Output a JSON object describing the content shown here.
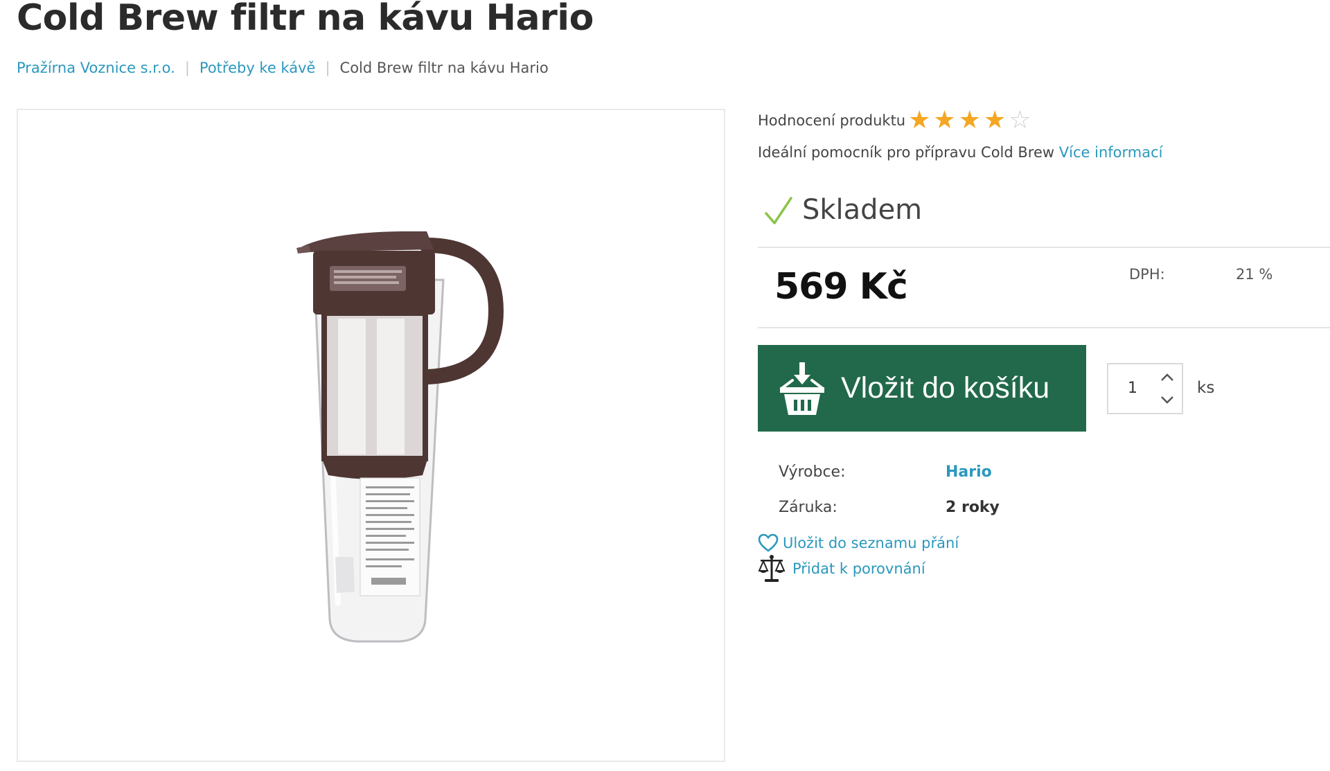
{
  "product": {
    "title": "Cold Brew filtr na kávu Hario"
  },
  "breadcrumb": {
    "items": [
      "Pražírna Voznice s.r.o.",
      "Potřeby ke kávě"
    ],
    "current": "Cold Brew filtr na kávu Hario",
    "separator": "|"
  },
  "image": {
    "alt_icon": "cold-brew-pitcher"
  },
  "rating": {
    "label": "Hodnocení produktu",
    "value": 4,
    "max": 5,
    "star_full": "★",
    "star_empty": "☆"
  },
  "short_description": {
    "text": "Ideální pomocník pro přípravu Cold Brew",
    "more_link": "Více informací"
  },
  "stock": {
    "label": "Skladem",
    "icon": "checkmark-icon"
  },
  "price": {
    "value": "569 Kč",
    "vat_label": "DPH:",
    "vat_value": "21 %"
  },
  "cart": {
    "button_label": "Vložit do košíku",
    "icon": "basket-icon",
    "quantity": "1",
    "unit": "ks"
  },
  "params": [
    {
      "label": "Výrobce:",
      "value": "Hario"
    },
    {
      "label": "Záruka:",
      "value": "2 roky"
    }
  ],
  "actions": {
    "wishlist": "Uložit do seznamu přání",
    "compare": "Přidat k porovnání"
  },
  "colors": {
    "accent_link": "#2a98bd",
    "cart_button": "#21694a",
    "star": "#f5a623",
    "stock_check": "#8bc34a"
  }
}
